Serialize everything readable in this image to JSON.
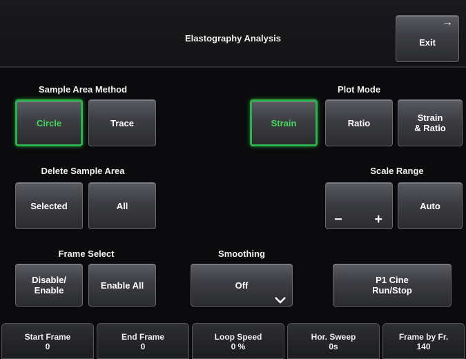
{
  "header": {
    "title": "Elastography Analysis",
    "exit_label": "Exit",
    "exit_arrow": "→"
  },
  "sample_area_method": {
    "label": "Sample Area Method",
    "circle": "Circle",
    "trace": "Trace",
    "active": "Circle"
  },
  "plot_mode": {
    "label": "Plot Mode",
    "strain": "Strain",
    "ratio": "Ratio",
    "strain_ratio": "Strain\n& Ratio",
    "active": "Strain"
  },
  "delete_sample_area": {
    "label": "Delete Sample Area",
    "selected": "Selected",
    "all": "All"
  },
  "scale_range": {
    "label": "Scale Range",
    "minus": "−",
    "plus": "+",
    "auto": "Auto"
  },
  "frame_select": {
    "label": "Frame Select",
    "disable_enable": "Disable/\nEnable",
    "enable_all": "Enable All"
  },
  "smoothing": {
    "label": "Smoothing",
    "value": "Off"
  },
  "p1_cine": {
    "label": "P1 Cine\nRun/Stop"
  },
  "bottom_tabs": [
    {
      "label": "Start Frame",
      "value": "0"
    },
    {
      "label": "End Frame",
      "value": "0"
    },
    {
      "label": "Loop Speed",
      "value": "0 %"
    },
    {
      "label": "Hor. Sweep",
      "value": "0s"
    },
    {
      "label": "Frame by Fr.",
      "value": "140"
    }
  ],
  "colors": {
    "active_border": "#2fb04a",
    "active_text": "#45d75e",
    "background": "#0b0b0d"
  }
}
